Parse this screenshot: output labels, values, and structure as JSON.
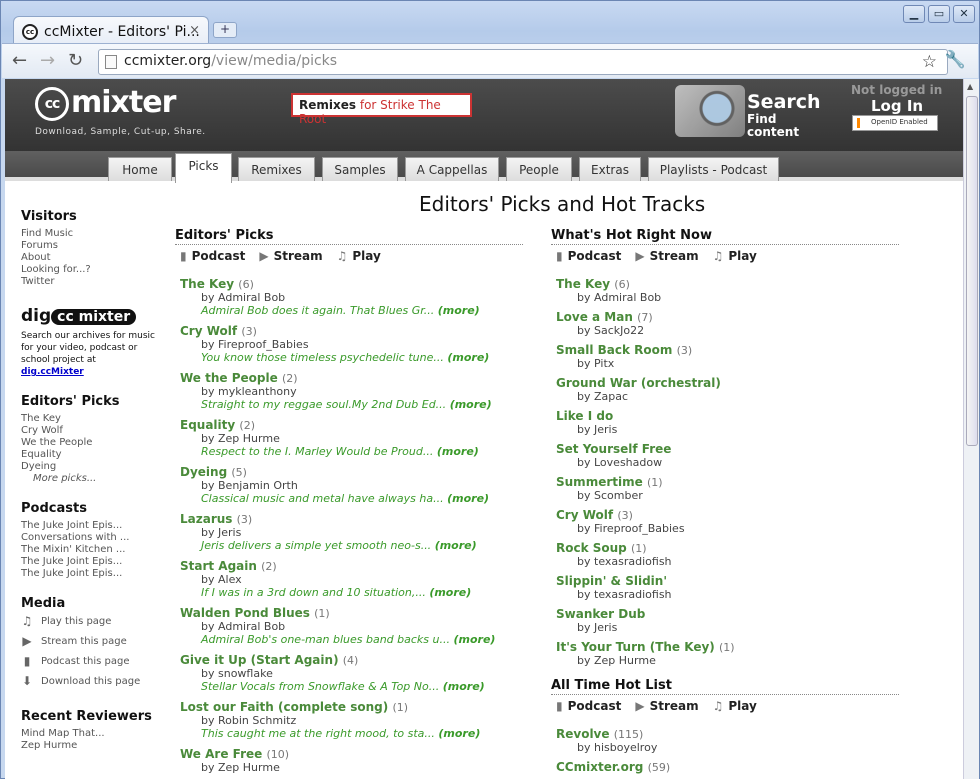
{
  "browser": {
    "tab_title": "ccMixter - Editors' Pi...",
    "url_domain": "ccmixter.org",
    "url_path": "/view/media/picks"
  },
  "header": {
    "logo_text": "mixter",
    "tagline": "Download, Sample, Cut-up, Share.",
    "remixes_label": "Remixes",
    "remixes_for": "for Strike The Root",
    "search_title": "Search",
    "search_sub": "Find content",
    "not_logged": "Not logged in",
    "login": "Log In",
    "openid": "OpenID Enabled"
  },
  "nav": [
    "Home",
    "Picks",
    "Remixes",
    "Samples",
    "A Cappellas",
    "People",
    "Extras",
    "Playlists - Podcast"
  ],
  "sidebar": {
    "visitors_title": "Visitors",
    "visitors": [
      "Find Music",
      "Forums",
      "About",
      "Looking for...?",
      "Twitter"
    ],
    "dig_logo": "dig",
    "dig_text": "Search our archives for music for your video, podcast or school project at",
    "dig_link": "dig.ccMixter",
    "picks_title": "Editors' Picks",
    "picks": [
      "The Key",
      "Cry Wolf",
      "We the People",
      "Equality",
      "Dyeing"
    ],
    "more_picks": "More picks...",
    "podcasts_title": "Podcasts",
    "podcasts": [
      "The Juke Joint Epis...",
      "Conversations with ...",
      "The Mixin' Kitchen ...",
      "The Juke Joint Epis...",
      "The Juke Joint Epis..."
    ],
    "media_title": "Media",
    "media": [
      "Play this page",
      "Stream this page",
      "Podcast this page",
      "Download this page"
    ],
    "reviewers_title": "Recent Reviewers",
    "reviewers": [
      "Mind Map That...",
      "Zep Hurme"
    ]
  },
  "page_title": "Editors' Picks and Hot Tracks",
  "actions": {
    "podcast": "Podcast",
    "stream": "Stream",
    "play": "Play"
  },
  "picks_header": "Editors' Picks",
  "picks": [
    {
      "t": "The Key",
      "n": "(6)",
      "a": "Admiral Bob",
      "d": "Admiral Bob does it again. That Blues Gr...",
      "m": "(more)"
    },
    {
      "t": "Cry Wolf",
      "n": "(3)",
      "a": "Fireproof_Babies",
      "d": "You know those timeless psychedelic tune...",
      "m": "(more)"
    },
    {
      "t": "We the People",
      "n": "(2)",
      "a": "mykleanthony",
      "d": "Straight to my reggae soul.My 2nd Dub Ed...",
      "m": "(more)"
    },
    {
      "t": "Equality",
      "n": "(2)",
      "a": "Zep Hurme",
      "d": "Respect to the I. Marley Would be Proud...",
      "m": "(more)"
    },
    {
      "t": "Dyeing",
      "n": "(5)",
      "a": "Benjamin Orth",
      "d": "Classical music and metal have always ha...",
      "m": "(more)"
    },
    {
      "t": "Lazarus",
      "n": "(3)",
      "a": "Jeris",
      "d": "Jeris delivers a simple yet smooth neo-s...",
      "m": "(more)"
    },
    {
      "t": "Start Again",
      "n": "(2)",
      "a": "Alex",
      "d": "If I was in a 3rd down and 10 situation,...",
      "m": "(more)"
    },
    {
      "t": "Walden Pond Blues",
      "n": "(1)",
      "a": "Admiral Bob",
      "d": "Admiral Bob's one-man blues band backs u...",
      "m": "(more)"
    },
    {
      "t": "Give it Up (Start Again)",
      "n": "(4)",
      "a": "snowflake",
      "d": "Stellar Vocals from Snowflake & A Top No...",
      "m": "(more)"
    },
    {
      "t": "Lost our Faith (complete song)",
      "n": "(1)",
      "a": "Robin Schmitz",
      "d": "This caught me at the right mood, to sta...",
      "m": "(more)"
    },
    {
      "t": "We Are Free",
      "n": "(10)",
      "a": "Zep Hurme",
      "d": "",
      "m": ""
    }
  ],
  "hot_header": "What's Hot Right Now",
  "hot": [
    {
      "t": "The Key",
      "n": "(6)",
      "a": "Admiral Bob"
    },
    {
      "t": "Love a Man",
      "n": "(7)",
      "a": "SackJo22"
    },
    {
      "t": "Small Back Room",
      "n": "(3)",
      "a": "Pitx"
    },
    {
      "t": "Ground War (orchestral)",
      "n": "",
      "a": "Zapac"
    },
    {
      "t": "Like I do",
      "n": "",
      "a": "Jeris"
    },
    {
      "t": "Set Yourself Free",
      "n": "",
      "a": "Loveshadow"
    },
    {
      "t": "Summertime",
      "n": "(1)",
      "a": "Scomber"
    },
    {
      "t": "Cry Wolf",
      "n": "(3)",
      "a": "Fireproof_Babies"
    },
    {
      "t": "Rock Soup",
      "n": "(1)",
      "a": "texasradiofish"
    },
    {
      "t": "Slippin' & Slidin'",
      "n": "",
      "a": "texasradiofish"
    },
    {
      "t": "Swanker Dub",
      "n": "",
      "a": "Jeris"
    },
    {
      "t": "It's Your Turn (The Key)",
      "n": "(1)",
      "a": "Zep Hurme"
    }
  ],
  "alltime_header": "All Time Hot List",
  "alltime": [
    {
      "t": "Revolve",
      "n": "(115)",
      "a": "hisboyelroy"
    },
    {
      "t": "CCmixter.org",
      "n": "(59)",
      "a": ""
    }
  ]
}
